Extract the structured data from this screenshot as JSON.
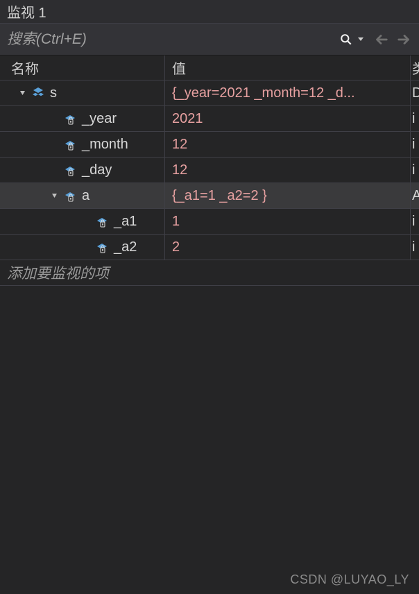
{
  "window": {
    "title": "监视 1"
  },
  "toolbar": {
    "search_placeholder": "搜索(Ctrl+E)"
  },
  "columns": {
    "name": "名称",
    "value": "值",
    "type": "类"
  },
  "rows": [
    {
      "depth": 0,
      "expander": "expanded",
      "icon": "struct",
      "name": "s",
      "value": "{_year=2021 _month=12 _d...",
      "type": "D"
    },
    {
      "depth": 1,
      "expander": "none",
      "icon": "field",
      "name": "_year",
      "value": "2021",
      "type": "i"
    },
    {
      "depth": 1,
      "expander": "none",
      "icon": "field",
      "name": "_month",
      "value": "12",
      "type": "i"
    },
    {
      "depth": 1,
      "expander": "none",
      "icon": "field",
      "name": "_day",
      "value": "12",
      "type": "i"
    },
    {
      "depth": 1,
      "expander": "expanded",
      "icon": "field",
      "name": "a",
      "value": "{_a1=1 _a2=2 }",
      "type": "A",
      "selected": true
    },
    {
      "depth": 2,
      "expander": "none",
      "icon": "field",
      "name": "_a1",
      "value": "1",
      "type": "i"
    },
    {
      "depth": 2,
      "expander": "none",
      "icon": "field",
      "name": "_a2",
      "value": "2",
      "type": "i"
    }
  ],
  "add_item_text": "添加要监视的项",
  "watermark": "CSDN @LUYAO_LY"
}
